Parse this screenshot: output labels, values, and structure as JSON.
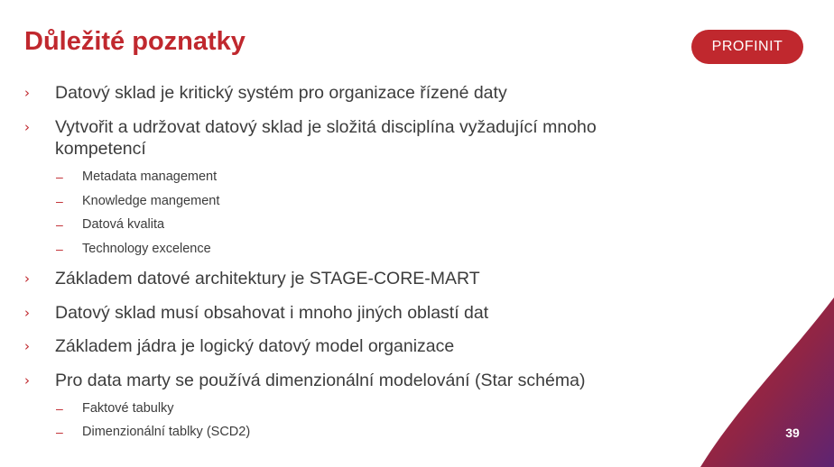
{
  "slide": {
    "title": "Důležité poznatky",
    "logo_text": "PROFINIT",
    "page_number": "39",
    "bullet_marker": "›",
    "sub_bullet_marker": "–",
    "colors": {
      "accent": "#c0282e",
      "text": "#3c3c3c",
      "gradient_start": "#c0282e",
      "gradient_end": "#5e2472"
    },
    "bullets": [
      {
        "text": "Datový sklad je kritický systém pro organizace řízené daty"
      },
      {
        "text": "Vytvořit a udržovat datový sklad je složitá disciplína vyžadující mnoho kompetencí",
        "sub": [
          "Metadata management",
          "Knowledge mangement",
          "Datová kvalita",
          "Technology excelence"
        ]
      },
      {
        "text": "Základem datové architektury je STAGE-CORE-MART"
      },
      {
        "text": "Datový sklad musí obsahovat i mnoho jiných oblastí dat"
      },
      {
        "text": "Základem jádra je logický datový model organizace"
      },
      {
        "text": "Pro data marty se používá dimenzionální modelování (Star schéma)",
        "sub": [
          "Faktové tabulky",
          "Dimenzionální tablky (SCD2)"
        ]
      }
    ]
  }
}
